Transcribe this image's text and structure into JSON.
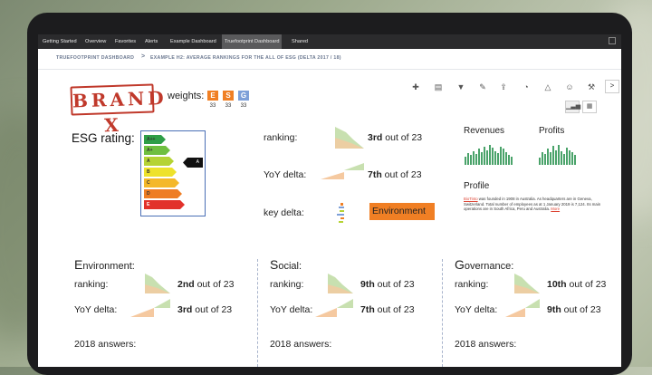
{
  "tabs": [
    {
      "label": "Getting Started",
      "active": false
    },
    {
      "label": "Overview",
      "active": false
    },
    {
      "label": "Favorites",
      "active": false
    },
    {
      "label": "Alerts",
      "active": false
    },
    {
      "label": "Example Dashboard",
      "active": false
    },
    {
      "label": "Truefootprint Dashboard",
      "active": true
    },
    {
      "label": "Shared",
      "active": false
    }
  ],
  "breadcrumb": {
    "root": "TRUEFOOTPRINT DASHBOARD",
    "separator": ">",
    "current": "EXAMPLE H2: AVERAGE RANKINGS FOR THE ALL OF ESG (DELTA 2017 / 18)"
  },
  "brand": {
    "logo_text": "BRAND X"
  },
  "weights": {
    "label": "weights:",
    "items": [
      {
        "letter": "E",
        "value": "33",
        "color": "#f07f24"
      },
      {
        "letter": "S",
        "value": "33",
        "color": "#f07f24"
      },
      {
        "letter": "G",
        "value": "33",
        "color": "#7ea0d8"
      }
    ]
  },
  "toolbar_icons": [
    "add-user-icon",
    "comment-icon",
    "filter-icon",
    "pencil-icon",
    "share-icon",
    "pie-chart-icon",
    "bell-icon",
    "users-icon",
    "wrench-icon"
  ],
  "side_toggle": ">",
  "view_toggle": {
    "chart_icon": "bar-chart-icon",
    "table_icon": "table-icon"
  },
  "esg_rating": {
    "label": "ESG rating:",
    "current": "A",
    "bands": [
      {
        "label": "A++",
        "color": "#2e9e47"
      },
      {
        "label": "A+",
        "color": "#6fbf3f"
      },
      {
        "label": "A",
        "color": "#b5d334"
      },
      {
        "label": "B",
        "color": "#eee22c"
      },
      {
        "label": "C",
        "color": "#f4b82a"
      },
      {
        "label": "D",
        "color": "#ee7d24"
      },
      {
        "label": "E",
        "color": "#e2322b"
      }
    ]
  },
  "overall": {
    "ranking": {
      "label": "ranking:",
      "position": "3rd",
      "suffix": " out of 23"
    },
    "yoy": {
      "label": "YoY delta:",
      "position": "7th",
      "suffix": " out of 23"
    },
    "key_delta": {
      "label": "key delta:",
      "value": "Environment"
    }
  },
  "revenues": {
    "label": "Revenues",
    "bars": [
      8,
      12,
      10,
      14,
      11,
      16,
      13,
      18,
      15,
      20,
      17,
      14,
      12,
      18,
      16,
      13,
      10,
      8
    ]
  },
  "profits": {
    "label": "Profits",
    "bars": [
      6,
      10,
      9,
      13,
      10,
      15,
      12,
      16,
      11,
      9,
      14,
      12,
      10,
      8
    ]
  },
  "profile": {
    "title": "Profile",
    "link": "BioTinto",
    "text": " was founded in 1908 in Australia. As headquarters are in Geneva, Switzerland. Total number of employees as at 1 January 2019 is 7,124. Its main operations are in South Africa, Peru and Australia.",
    "more": "More"
  },
  "sections": [
    {
      "initial": "E",
      "rest": "nvironment:",
      "rank_label": "ranking:",
      "rank": "2nd",
      "yoy_label": "YoY delta:",
      "yoy": "3rd",
      "suffix": " out of 23",
      "answers": "2018 answers:"
    },
    {
      "initial": "S",
      "rest": "ocial:",
      "rank_label": "ranking:",
      "rank": "9th",
      "yoy_label": "YoY delta:",
      "yoy": "7th",
      "suffix": " out of 23",
      "answers": "2018 answers:"
    },
    {
      "initial": "G",
      "rest": "overnance:",
      "rank_label": "ranking:",
      "rank": "10th",
      "yoy_label": "YoY delta:",
      "yoy": "9th",
      "suffix": " out of 23",
      "answers": "2018 answers:"
    }
  ]
}
